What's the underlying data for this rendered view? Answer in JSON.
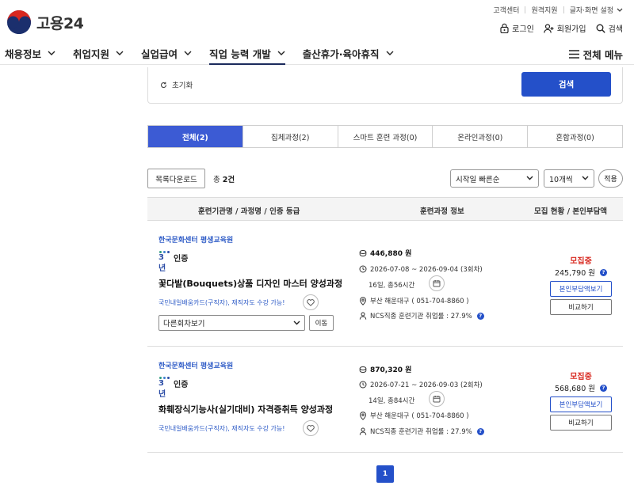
{
  "header": {
    "logo_text": "고용24",
    "util_top": [
      "고객센터",
      "원격지원",
      "글자·화면 설정"
    ],
    "util_bottom": {
      "login": "로그인",
      "signup": "회원가입",
      "search": "검색"
    },
    "nav": [
      "채용정보",
      "취업지원",
      "실업급여",
      "직업 능력 개발",
      "출산휴가·육아휴직"
    ],
    "nav_active": "직업 능력 개발",
    "all_menu": "전체 메뉴"
  },
  "search_panel": {
    "reset_label": "초기화",
    "search_button": "검색"
  },
  "tabs": [
    "전체(2)",
    "집체과정(2)",
    "스마트 훈련 과정(0)",
    "온라인과정(0)",
    "혼합과정(0)"
  ],
  "toolbar": {
    "download_button": "목록다운로드",
    "total_prefix": "총",
    "total_count": "2건",
    "sort_selected": "시작일 빠른순",
    "count_selected": "10개씩",
    "apply_button": "적용"
  },
  "table": {
    "columns": [
      "훈련기관명 / 과정명 / 인증 등급",
      "훈련과정 정보",
      "모집 현황 / 본인부담액"
    ],
    "rows": [
      {
        "institution": "한국문화센터 평생교육원",
        "cert_mark": "3년",
        "cert_label": "인증",
        "title": "꽃다발(Bouquets)상품 디자인 마스터 양성과정",
        "card_note": "국민내일배움카드(구직자), 재직자도 수강 가능!",
        "round_select": "다른회차보기",
        "move_button": "이동",
        "price": "446,880 원",
        "period": "2026-07-08 ~ 2026-09-04 (3회차)",
        "duration": "16일, 총56시간",
        "location": "부산 해운대구 ( 051-704-8860 )",
        "employment_rate": "NCS직종 훈련기관 취업률 : 27.9%",
        "status": "모집중",
        "self_cost": "245,790 원",
        "cost_button": "본인부담액보기",
        "compare_button": "비교하기"
      },
      {
        "institution": "한국문화센터 평생교육원",
        "cert_mark": "3년",
        "cert_label": "인증",
        "title": "화훼장식기능사(실기대비) 자격증취득 양성과정",
        "card_note": "국민내일배움카드(구직자), 재직자도 수강 가능!",
        "price": "870,320 원",
        "period": "2026-07-21 ~ 2026-09-03 (2회차)",
        "duration": "14일, 총84시간",
        "location": "부산 해운대구 ( 051-704-8860 )",
        "employment_rate": "NCS직종 훈련기관 취업률 : 27.9%",
        "status": "모집중",
        "self_cost": "568,680 원",
        "cost_button": "본인부담액보기",
        "compare_button": "비교하기"
      }
    ]
  },
  "pagination": {
    "current_page": "1"
  },
  "icons": {
    "qmark": "?",
    "cert_dot_colors": [
      "#2c9a7d",
      "#3c7fd0",
      "#2c4da6"
    ]
  },
  "colors": {
    "primary_blue": "#2450c9",
    "tab_active": "#3c5bd4",
    "status_red": "#d8281f",
    "link_blue": "#2f5cc7",
    "nav_underline": "#1b2a5c"
  }
}
